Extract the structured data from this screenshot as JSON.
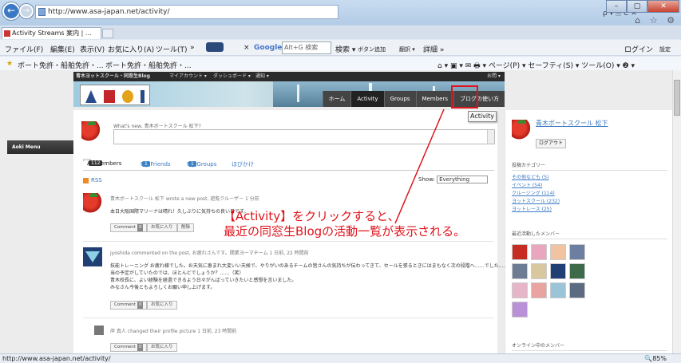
{
  "browser": {
    "url": "http://www.asa-japan.net/activity/",
    "addr_tools": "ρ ▾ 🗎 C ✕",
    "tab_title": "Activity Streams 案内 | ...",
    "window_buttons": [
      "–",
      "▢",
      "✕"
    ],
    "right_icons": "⌂ ☆ ⚙",
    "menu": [
      "ファイル(F)",
      "編集(E)",
      "表示(V)",
      "お気に入り(A)",
      "ツール(T)"
    ],
    "toolbar": {
      "more": "»",
      "close": "×",
      "google": "Google",
      "search_box": "Alt+G 検索",
      "search_btn": "検索 ▾",
      "btn_add": "ボタン追加",
      "translate": "翻訳 ▾",
      "details": "詳細 »",
      "login": "ログイン",
      "settings": "設定"
    },
    "favorites": [
      "ボート免許・船舶免許・...",
      "ボート免許・船舶免許・..."
    ],
    "cmd": "⌂ ▾ ▣ ▾ ✉ 🖶 ▾ ページ(P) ▾ セーフティ(S) ▾ ツール(O) ▾ ❷ ▾",
    "status_url": "http://www.asa-japan.net/activity/",
    "zoom": "🔍85%"
  },
  "site": {
    "adminbar": [
      "青木ヨットスクール・同窓生Blog",
      "マイアカウント ▾",
      "ダッシュボード ▾",
      "通知 ▾",
      "お問 ▾"
    ],
    "nav": [
      "ホーム",
      "Activity",
      "Groups",
      "Members",
      "ブログの使い方"
    ],
    "tooltip": "Activity",
    "left_widget": "Aoki Menu",
    "whats_new": "What's new, 青木ボートスクール 松下?",
    "tabs": [
      {
        "label": "All Members",
        "count": "112"
      },
      {
        "label": "My Friends",
        "count": "1"
      },
      {
        "label": "My Groups",
        "count": "1"
      },
      {
        "label": "ほびかけ",
        "count": ""
      }
    ],
    "rss": "RSS",
    "show_label": "Show:",
    "show_value": "Everything",
    "activity": [
      {
        "header": "青木ボートスクール 松下 wrote a new post, 遊覧クルーザー 1 分前",
        "body": [
          "本日大阪国際マリーナは晴れ！久しぶりに気持ちの良い日です。"
        ],
        "buttons": [
          "Comment",
          "お気に入り",
          "削除"
        ],
        "comment_count": "0"
      },
      {
        "header": "jyoshida commented on the post, お疲れさんです。開業ヨーマチーム 1 日前, 22 時間前",
        "body": [
          "技能トレーニング お疲れ様でした。お天気に恵まれ大変いい天候で、やりがいのあるチームの皆さんの気持ちが伝わってきて、セールを張るときにはまもなく次の段階へ……でした……一時（もみ彩",
          "当の予定がしていたのでは、ほとんどでしょうか？……（笑）",
          "青木校長に、よい経験を経過できるよう日々がんばっていきたいと感想を言いました。",
          "みなさん今後ともよろしくお願い申し上げます。"
        ],
        "buttons": [
          "Comment",
          "お気に入り"
        ],
        "comment_count": "0"
      },
      {
        "header": "岸 真人 changed their profile picture 1 日前, 23 時間前",
        "body": [],
        "buttons": [
          "Comment",
          "お気に入り"
        ],
        "comment_count": "0"
      }
    ]
  },
  "sidebar": {
    "profile_name": "青木ボートスクール 松下",
    "logout": "ログアウト",
    "cat_title": "投稿カテゴリー",
    "categories": [
      "その他なども (5)",
      "イベント (54)",
      "クルージング (114)",
      "ヨットスクール (232)",
      "ヨットレース (25)"
    ],
    "members_title": "最近活動したメンバー",
    "online_title": "オンライン中のメンバー"
  },
  "annotation": {
    "line1": "【Activity】をクリックすると、",
    "line2": "最近の同窓生Blogの活動一覧が表示される。"
  },
  "colors": {
    "accent": "#e0131b",
    "link": "#3b78c4",
    "nav_bg": "#444444"
  }
}
